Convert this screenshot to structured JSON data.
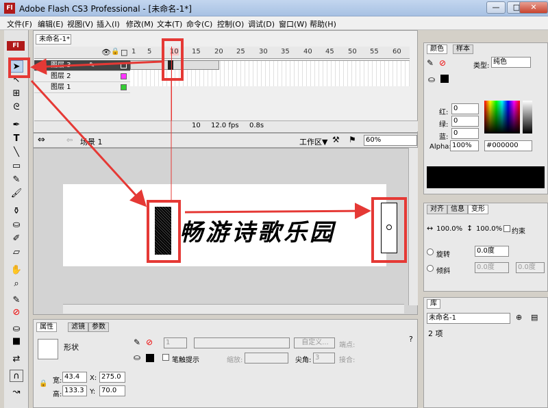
{
  "window": {
    "title": "Adobe Flash CS3 Professional - [未命名-1*]",
    "logo": "Fl",
    "min_label": "—",
    "max_label": "□",
    "close_label": "✕"
  },
  "menu": [
    "文件(F)",
    "编辑(E)",
    "视图(V)",
    "插入(I)",
    "修改(M)",
    "文本(T)",
    "命令(C)",
    "控制(O)",
    "调试(D)",
    "窗口(W)",
    "帮助(H)"
  ],
  "document": {
    "tab": "未命名-1*"
  },
  "timeline": {
    "ruler": [
      "1",
      "5",
      "10",
      "15",
      "20",
      "25",
      "30",
      "35",
      "40",
      "45",
      "50",
      "55",
      "60"
    ],
    "layers": [
      {
        "name": "图层 3",
        "color": "#ffffff"
      },
      {
        "name": "图层 2",
        "color": "#ff33ff"
      },
      {
        "name": "图层 1",
        "color": "#33cc33"
      }
    ],
    "current_frame": "10",
    "fps": "12.0 fps",
    "time": "0.8s"
  },
  "stage": {
    "scene": "场景 1",
    "workspace": "工作区▼",
    "zoom": "60%",
    "text": "畅游诗歌乐园"
  },
  "properties": {
    "tabs": [
      "属性",
      "滤镜",
      "参数"
    ],
    "type": "形状",
    "stroke_size": "1",
    "custom_btn": "自定义...",
    "endpoint": "端点:",
    "stroke_hint": "笔触提示",
    "scale": "缩放:",
    "sharp": "尖角:",
    "sharp_val": "3",
    "join": "接合:",
    "w_label": "宽:",
    "w_val": "43.4",
    "h_label": "高:",
    "h_val": "133.3",
    "x_label": "X:",
    "x_val": "275.0",
    "y_label": "Y:",
    "y_val": "70.0"
  },
  "color_panel": {
    "tabs": [
      "颜色",
      "样本"
    ],
    "type_label": "类型:",
    "type_val": "纯色",
    "r_label": "红:",
    "r_val": "0",
    "g_label": "绿:",
    "g_val": "0",
    "b_label": "蓝:",
    "b_val": "0",
    "alpha_label": "Alpha:",
    "alpha_val": "100%",
    "hex": "#000000"
  },
  "transform_panel": {
    "tabs": [
      "对齐",
      "信息",
      "变形"
    ],
    "w_pct": "100.0%",
    "h_pct": "100.0%",
    "constrain": "约束",
    "rotate": "旋转",
    "rotate_val": "0.0度",
    "skew": "倾斜",
    "skew_h": "0.0度",
    "skew_v": "0.0度"
  },
  "library_panel": {
    "tab": "库",
    "doc": "未命名-1",
    "count": "2 项"
  },
  "colors": {
    "annotation": "#e53935",
    "shape_fill": "#000000"
  }
}
